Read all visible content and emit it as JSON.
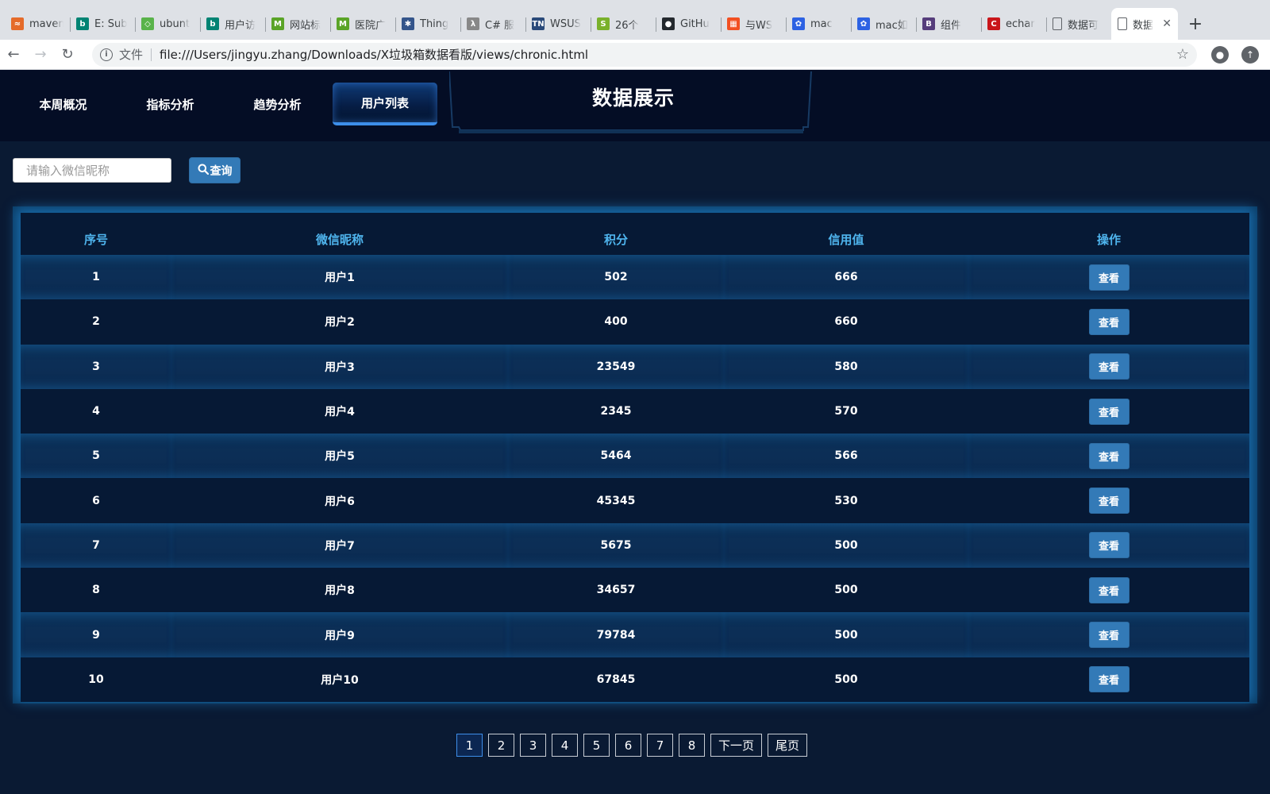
{
  "browser": {
    "tabs": [
      {
        "title": "maven",
        "icon": "maven-icon",
        "color": "#e56b2a",
        "glyph": "≈"
      },
      {
        "title": "E: Sub",
        "icon": "bing-icon",
        "color": "#008373",
        "glyph": "b"
      },
      {
        "title": "ubunt",
        "icon": "sourceforge-icon",
        "color": "#59b34a",
        "glyph": "◇"
      },
      {
        "title": "用户访",
        "icon": "bing-icon",
        "color": "#008373",
        "glyph": "b"
      },
      {
        "title": "网站标",
        "icon": "m-icon",
        "color": "#5aa427",
        "glyph": "M"
      },
      {
        "title": "医院广",
        "icon": "m-icon",
        "color": "#5aa427",
        "glyph": "M"
      },
      {
        "title": "Thing",
        "icon": "gear-icon",
        "color": "#34558b",
        "glyph": "✱"
      },
      {
        "title": "C# 服",
        "icon": "csharp-icon",
        "color": "#888888",
        "glyph": "λ"
      },
      {
        "title": "WSUS",
        "icon": "tn-icon",
        "color": "#2a4a7a",
        "glyph": "TN"
      },
      {
        "title": "26个",
        "icon": "s-icon",
        "color": "#7ab12b",
        "glyph": "S"
      },
      {
        "title": "GitHu",
        "icon": "github-icon",
        "color": "#24292e",
        "glyph": "●"
      },
      {
        "title": "与WS",
        "icon": "microsoft-icon",
        "color": "#f25022",
        "glyph": "▦"
      },
      {
        "title": "mac",
        "icon": "baidu-icon",
        "color": "#2d62e3",
        "glyph": "✿"
      },
      {
        "title": "mac如",
        "icon": "baidu-icon",
        "color": "#2d62e3",
        "glyph": "✿"
      },
      {
        "title": "组件",
        "icon": "bootstrap-icon",
        "color": "#563d7c",
        "glyph": "B"
      },
      {
        "title": "echar",
        "icon": "csdn-icon",
        "color": "#c9161b",
        "glyph": "C"
      },
      {
        "title": "数据可",
        "icon": "page-icon",
        "color": "#dee1e6",
        "glyph": "▯"
      },
      {
        "title": "数据",
        "icon": "page-icon",
        "color": "#ffffff",
        "glyph": "▯",
        "active": true
      }
    ],
    "protocol_label": "文件",
    "url": "file:///Users/jingyu.zhang/Downloads/X垃圾箱数据看版/views/chronic.html"
  },
  "header": {
    "title": "数据展示",
    "nav": [
      {
        "label": "本周概况"
      },
      {
        "label": "指标分析"
      },
      {
        "label": "趋势分析"
      },
      {
        "label": "用户列表",
        "active": true
      }
    ]
  },
  "search": {
    "placeholder": "请输入微信昵称",
    "value": "",
    "button_label": "查询"
  },
  "table": {
    "columns": [
      "序号",
      "微信昵称",
      "积分",
      "信用值",
      "操作"
    ],
    "rows": [
      {
        "id": "1",
        "name": "用户1",
        "score": "502",
        "credit": "666"
      },
      {
        "id": "2",
        "name": "用户2",
        "score": "400",
        "credit": "660"
      },
      {
        "id": "3",
        "name": "用户3",
        "score": "23549",
        "credit": "580"
      },
      {
        "id": "4",
        "name": "用户4",
        "score": "2345",
        "credit": "570"
      },
      {
        "id": "5",
        "name": "用户5",
        "score": "5464",
        "credit": "566"
      },
      {
        "id": "6",
        "name": "用户6",
        "score": "45345",
        "credit": "530"
      },
      {
        "id": "7",
        "name": "用户7",
        "score": "5675",
        "credit": "500"
      },
      {
        "id": "8",
        "name": "用户8",
        "score": "34657",
        "credit": "500"
      },
      {
        "id": "9",
        "name": "用户9",
        "score": "79784",
        "credit": "500"
      },
      {
        "id": "10",
        "name": "用户10",
        "score": "67845",
        "credit": "500"
      }
    ],
    "action_label": "查看"
  },
  "pagination": {
    "pages": [
      "1",
      "2",
      "3",
      "4",
      "5",
      "6",
      "7",
      "8"
    ],
    "current": "1",
    "next_label": "下一页",
    "last_label": "尾页"
  },
  "colors": {
    "page_bg": "#0a1a33",
    "header_bg": "#040d25",
    "accent": "#3d8eea",
    "button": "#337ab7",
    "column_header": "#4fb5ee"
  }
}
